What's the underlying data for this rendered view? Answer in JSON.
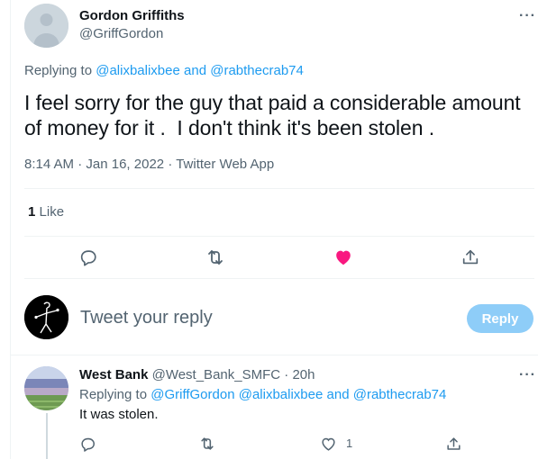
{
  "main_tweet": {
    "author_name": "Gordon Griffiths",
    "author_handle": "@GriffGordon",
    "more": "···",
    "replying_prefix": "Replying to",
    "replying_user_1": "@alixbalixbee",
    "replying_and": "and",
    "replying_user_2": "@rabthecrab74",
    "text_line_1": "I feel sorry for the guy that paid a considerable amount",
    "text_line_2": "of money for it .  I don't think it's been stolen .",
    "time": "8:14 AM",
    "date": "Jan 16, 2022",
    "source": "Twitter Web App",
    "sep": "·",
    "like_count": "1",
    "like_label": "Like"
  },
  "composer": {
    "placeholder": "Tweet your reply",
    "button": "Reply"
  },
  "reply_tweet": {
    "author_name": "West Bank",
    "author_handle": "@West_Bank_SMFC",
    "sep": "·",
    "age": "20h",
    "more": "···",
    "replying_prefix": "Replying to",
    "replying_user_1": "@GriffGordon",
    "replying_user_2": "@alixbalixbee",
    "replying_and": "and",
    "replying_user_3": "@rabthecrab74",
    "text": "It was stolen.",
    "like_count": "1"
  },
  "colors": {
    "accent": "#1d9bf0",
    "like_active": "#f91880",
    "muted": "#536471",
    "reply_button_disabled": "#8ecdf8"
  },
  "icons": {
    "reply": "reply-icon",
    "retweet": "retweet-icon",
    "like": "heart-icon",
    "share": "share-icon",
    "more": "more-icon"
  }
}
